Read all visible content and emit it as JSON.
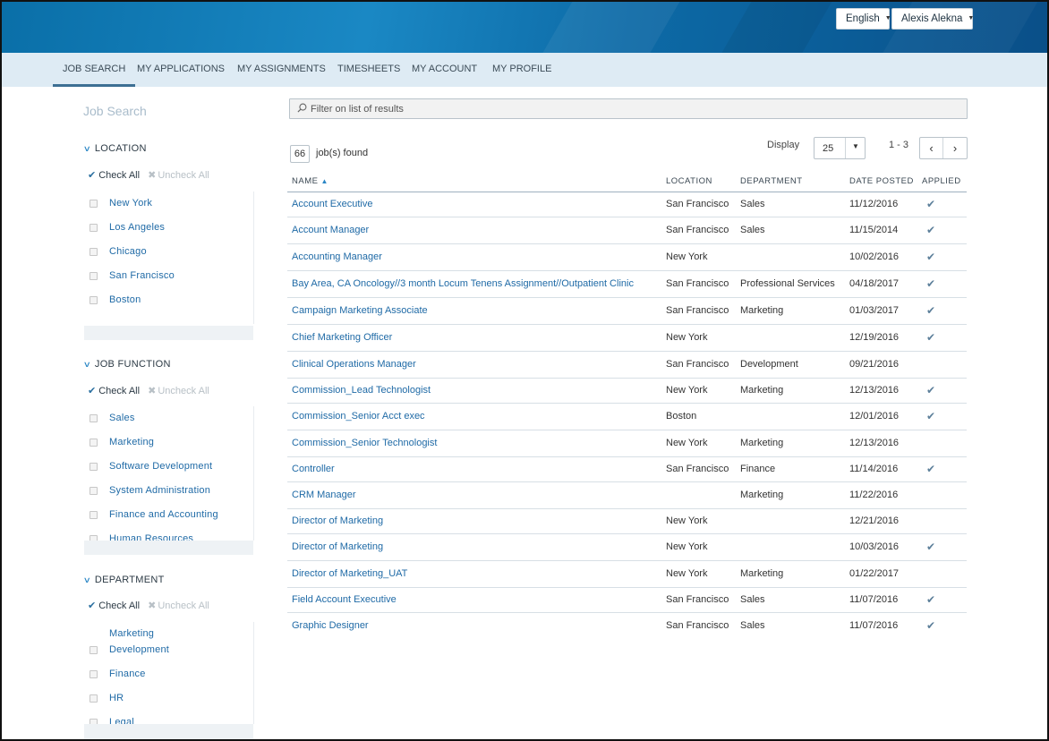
{
  "header": {
    "language": "English",
    "user": "Alexis Alekna"
  },
  "nav": {
    "items": [
      {
        "label": "JOB SEARCH",
        "active": true
      },
      {
        "label": "MY APPLICATIONS",
        "active": false
      },
      {
        "label": "MY ASSIGNMENTS",
        "active": false
      },
      {
        "label": "TIMESHEETS",
        "active": false
      },
      {
        "label": "MY ACCOUNT",
        "active": false
      },
      {
        "label": "MY PROFILE",
        "active": false
      }
    ]
  },
  "sidebar": {
    "title": "Job Search",
    "check_all": "Check All",
    "uncheck_all": "Uncheck All",
    "facets": [
      {
        "label": "LOCATION",
        "options": [
          "New York",
          "Los Angeles",
          "Chicago",
          "San Francisco",
          "Boston"
        ]
      },
      {
        "label": "JOB FUNCTION",
        "options": [
          "Sales",
          "Marketing",
          "Software Development",
          "System Administration",
          "Finance and Accounting",
          "Human Resources"
        ]
      },
      {
        "label": "DEPARTMENT",
        "options": [
          "Marketing",
          "Development",
          "Finance",
          "HR",
          "Legal"
        ]
      }
    ]
  },
  "main": {
    "filter_placeholder": "Filter on list of results",
    "count": "66",
    "found_label": "job(s) found",
    "display_label": "Display",
    "per_page": "25",
    "range": "1 - 3",
    "columns": [
      "NAME",
      "LOCATION",
      "DEPARTMENT",
      "DATE POSTED",
      "APPLIED"
    ],
    "rows": [
      {
        "name": "Account Executive",
        "location": "San Francisco",
        "department": "Sales",
        "date": "11/12/2016",
        "applied": "✔"
      },
      {
        "name": "Account Manager",
        "location": "San Francisco",
        "department": "Sales",
        "date": "11/15/2014",
        "applied": "✔"
      },
      {
        "name": "Accounting Manager",
        "location": "New York",
        "department": "",
        "date": "10/02/2016",
        "applied": "✔"
      },
      {
        "name": "Bay Area, CA Oncology//3 month Locum Tenens Assignment//Outpatient Clinic",
        "location": "San Francisco",
        "department": "Professional Services",
        "date": "04/18/2017",
        "applied": "✔"
      },
      {
        "name": "Campaign Marketing Associate",
        "location": "San Francisco",
        "department": "Marketing",
        "date": "01/03/2017",
        "applied": "✔"
      },
      {
        "name": "Chief Marketing Officer",
        "location": "New York",
        "department": "",
        "date": "12/19/2016",
        "applied": "✔"
      },
      {
        "name": "Clinical Operations Manager",
        "location": "San Francisco",
        "department": "Development",
        "date": "09/21/2016",
        "applied": ""
      },
      {
        "name": "Commission_Lead Technologist",
        "location": "New York",
        "department": "Marketing",
        "date": "12/13/2016",
        "applied": "✔"
      },
      {
        "name": "Commission_Senior Acct exec",
        "location": "Boston",
        "department": "",
        "date": "12/01/2016",
        "applied": "✔"
      },
      {
        "name": "Commission_Senior Technologist",
        "location": "New York",
        "department": "Marketing",
        "date": "12/13/2016",
        "applied": ""
      },
      {
        "name": "Controller",
        "location": "San Francisco",
        "department": "Finance",
        "date": "11/14/2016",
        "applied": "✔"
      },
      {
        "name": "CRM Manager",
        "location": "",
        "department": "Marketing",
        "date": "11/22/2016",
        "applied": ""
      },
      {
        "name": "Director of Marketing",
        "location": "New York",
        "department": "",
        "date": "12/21/2016",
        "applied": ""
      },
      {
        "name": "Director of Marketing",
        "location": "New York",
        "department": "",
        "date": "10/03/2016",
        "applied": "✔"
      },
      {
        "name": "Director of Marketing_UAT",
        "location": "New York",
        "department": "Marketing",
        "date": "01/22/2017",
        "applied": ""
      },
      {
        "name": "Field Account Executive",
        "location": "San Francisco",
        "department": "Sales",
        "date": "11/07/2016",
        "applied": "✔"
      },
      {
        "name": "Graphic Designer",
        "location": "San Francisco",
        "department": "Sales",
        "date": "11/07/2016",
        "applied": "✔"
      }
    ]
  }
}
